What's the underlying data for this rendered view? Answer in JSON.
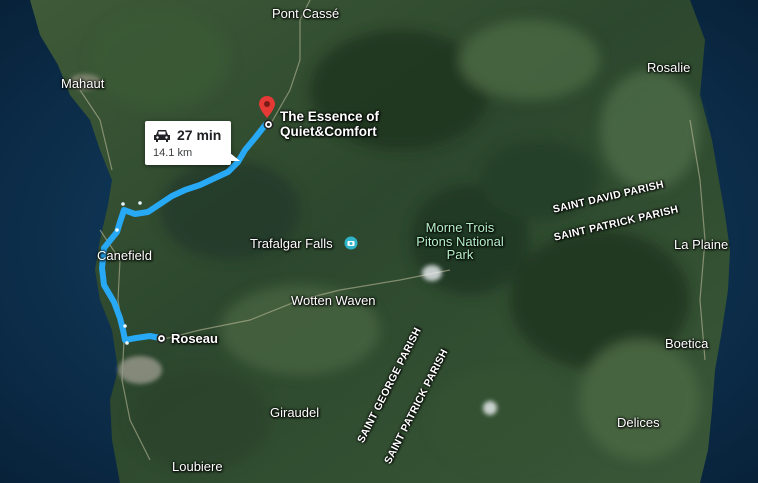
{
  "places": {
    "pont_casse": "Pont Cassé",
    "mahaut": "Mahaut",
    "rosalie": "Rosalie",
    "canefield": "Canefield",
    "trafalgar_falls": "Trafalgar Falls",
    "la_plaine": "La Plaine",
    "wotten_waven": "Wotten Waven",
    "roseau": "Roseau",
    "boetica": "Boetica",
    "giraudel": "Giraudel",
    "delices": "Delices",
    "loubiere": "Loubiere"
  },
  "park": "Morne Trois Pitons National Park",
  "parishes": {
    "saint_david": "SAINT DAVID PARISH",
    "saint_patrick_east": "SAINT PATRICK PARISH",
    "saint_george": "SAINT GEORGE PARISH",
    "saint_patrick_south": "SAINT PATRICK PARISH"
  },
  "destination": {
    "name": "The Essence of Quiet&Comfort",
    "icon": "red-pin-icon"
  },
  "origin_icon": "origin-circle-icon",
  "route": {
    "mode_icon": "car-icon",
    "duration": "27 min",
    "distance": "14.1 km",
    "color": "#27a9f5"
  },
  "colors": {
    "sea": "#0d3556",
    "land_dark": "#233c26",
    "land_mid": "#3c5a3a",
    "pin": "#e53935"
  }
}
